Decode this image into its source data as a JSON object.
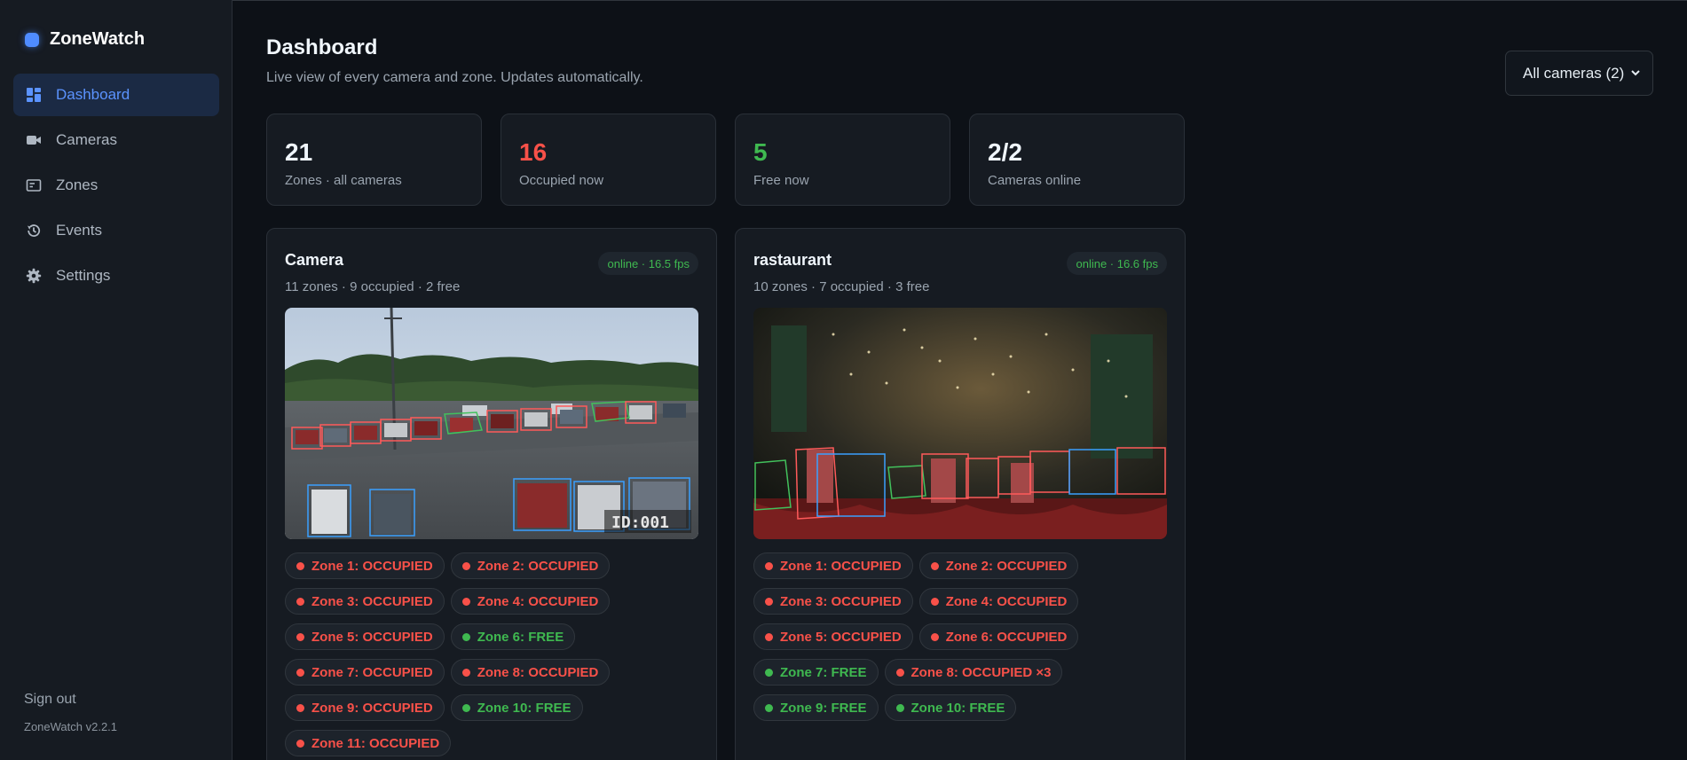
{
  "app": {
    "name": "ZoneWatch",
    "version": "ZoneWatch v2.2.1",
    "accent": "#4f8cff"
  },
  "sidebar": {
    "items": [
      {
        "label": "Dashboard",
        "icon": "dashboard-icon",
        "active": true
      },
      {
        "label": "Cameras",
        "icon": "video-camera-icon"
      },
      {
        "label": "Zones",
        "icon": "zones-icon"
      },
      {
        "label": "Events",
        "icon": "history-icon"
      },
      {
        "label": "Settings",
        "icon": "gear-icon"
      }
    ],
    "sign_out": "Sign out"
  },
  "header": {
    "title": "Dashboard",
    "subtitle": "Live view of every camera and zone. Updates automatically.",
    "camera_filter": "All cameras (2)"
  },
  "stats": [
    {
      "value": "21",
      "label": "Zones · all cameras",
      "color": "#f0f6fc"
    },
    {
      "value": "16",
      "label": "Occupied now",
      "color": "#f85149"
    },
    {
      "value": "5",
      "label": "Free now",
      "color": "#3fb950"
    },
    {
      "value": "2/2",
      "label": "Cameras online",
      "color": "#f0f6fc"
    }
  ],
  "status_colors": {
    "occupied": "#f85149",
    "free": "#3fb950"
  },
  "cameras": [
    {
      "name": "Camera",
      "status": "online · 16.5 fps",
      "summary": "11 zones · 9 occupied · 2 free",
      "image_overlay_text": "ID:001",
      "zones": [
        {
          "label": "Zone 1: OCCUPIED",
          "state": "occupied"
        },
        {
          "label": "Zone 2: OCCUPIED",
          "state": "occupied"
        },
        {
          "label": "Zone 3: OCCUPIED",
          "state": "occupied"
        },
        {
          "label": "Zone 4: OCCUPIED",
          "state": "occupied"
        },
        {
          "label": "Zone 5: OCCUPIED",
          "state": "occupied"
        },
        {
          "label": "Zone 6: FREE",
          "state": "free"
        },
        {
          "label": "Zone 7: OCCUPIED",
          "state": "occupied"
        },
        {
          "label": "Zone 8: OCCUPIED",
          "state": "occupied"
        },
        {
          "label": "Zone 9: OCCUPIED",
          "state": "occupied"
        },
        {
          "label": "Zone 10: FREE",
          "state": "free"
        },
        {
          "label": "Zone 11: OCCUPIED",
          "state": "occupied"
        }
      ]
    },
    {
      "name": "rastaurant",
      "status": "online · 16.6 fps",
      "summary": "10 zones · 7 occupied · 3 free",
      "zones": [
        {
          "label": "Zone 1: OCCUPIED",
          "state": "occupied"
        },
        {
          "label": "Zone 2: OCCUPIED",
          "state": "occupied"
        },
        {
          "label": "Zone 3: OCCUPIED",
          "state": "occupied"
        },
        {
          "label": "Zone 4: OCCUPIED",
          "state": "occupied"
        },
        {
          "label": "Zone 5: OCCUPIED",
          "state": "occupied"
        },
        {
          "label": "Zone 6: OCCUPIED",
          "state": "occupied"
        },
        {
          "label": "Zone 7: FREE",
          "state": "free"
        },
        {
          "label": "Zone 8: OCCUPIED ×3",
          "state": "occupied"
        },
        {
          "label": "Zone 9: FREE",
          "state": "free"
        },
        {
          "label": "Zone 10: FREE",
          "state": "free"
        }
      ]
    }
  ]
}
